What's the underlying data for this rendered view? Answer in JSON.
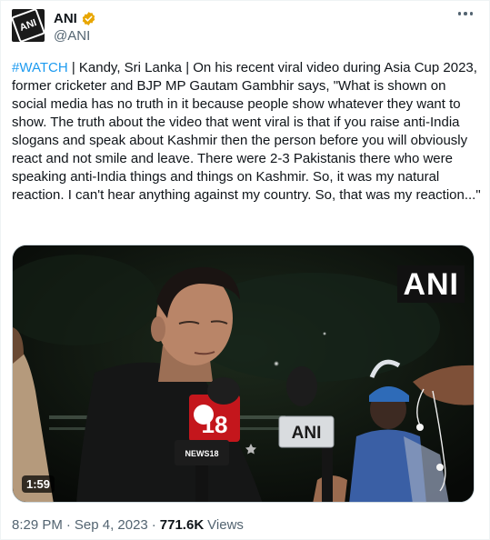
{
  "author": {
    "avatar_text": "ANI",
    "display_name": "ANI",
    "handle": "@ANI",
    "verified_color": "#e8a600"
  },
  "tweet": {
    "hashtag": "#WATCH",
    "body": " | Kandy, Sri Lanka | On his recent viral video during Asia Cup 2023, former cricketer and BJP MP Gautam Gambhir says, \"What is shown on social media has no truth in it because people show whatever they want to show. The truth about the video that went viral is that if you raise anti-India slogans and speak about Kashmir then the person before you will obviously react and not smile and leave. There were 2-3 Pakistanis there who were speaking anti-India things and things on Kashmir. So, it was my natural reaction. I can't hear anything against my country. So, that was my reaction...\""
  },
  "media": {
    "watermark": "ANI",
    "duration": "1:59",
    "mic_label": "ANI",
    "mic_channel": "18",
    "mic_news_label": "NEWS18"
  },
  "meta": {
    "time": "8:29 PM",
    "separator": "·",
    "date": "Sep 4, 2023",
    "views_count": "771.6K",
    "views_label": "Views"
  },
  "colors": {
    "link": "#1d9bf0",
    "secondary_text": "#536471",
    "primary_text": "#0f1419"
  }
}
